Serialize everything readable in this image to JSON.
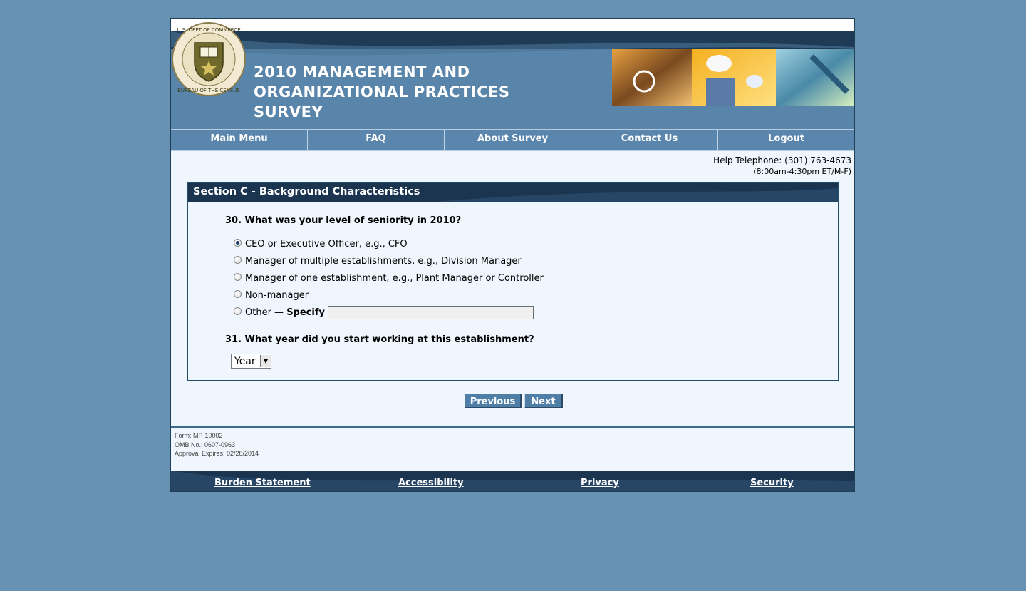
{
  "header": {
    "title_line1": "2010 MANAGEMENT AND",
    "title_line2": "ORGANIZATIONAL PRACTICES",
    "title_line3": "SURVEY",
    "seal_text": "U.S. DEPARTMENT OF COMMERCE · BUREAU OF THE CENSUS"
  },
  "nav": {
    "items": [
      "Main Menu",
      "FAQ",
      "About Survey",
      "Contact Us",
      "Logout"
    ]
  },
  "help": {
    "phone": "Help Telephone: (301) 763-4673",
    "hours": "(8:00am-4:30pm ET/M-F)"
  },
  "section": {
    "title": "Section C - Background Characteristics",
    "q30": {
      "text": "30. What was your level of seniority in 2010?",
      "options": [
        "CEO or Executive Officer, e.g., CFO",
        "Manager of multiple establishments, e.g., Division Manager",
        "Manager of one establishment, e.g., Plant Manager or Controller",
        "Non-manager",
        "Other — "
      ],
      "specify_label": "Specify",
      "specify_value": "",
      "selected_index": 0
    },
    "q31": {
      "text": "31. What year did you start working at this establishment?",
      "select_value": "Year"
    }
  },
  "buttons": {
    "previous": "Previous",
    "next": "Next"
  },
  "form_info": {
    "form": "Form: MP-10002",
    "omb": "OMB No.: 0607-0963",
    "expires": "Approval Expires: 02/28/2014"
  },
  "footer": {
    "links": [
      "Burden Statement",
      "Accessibility",
      "Privacy",
      "Security"
    ]
  },
  "colors": {
    "background": "#6892b4",
    "header_blue": "#5a85ab",
    "dark_navy": "#1b3551",
    "content_bg": "#eff6fd"
  }
}
